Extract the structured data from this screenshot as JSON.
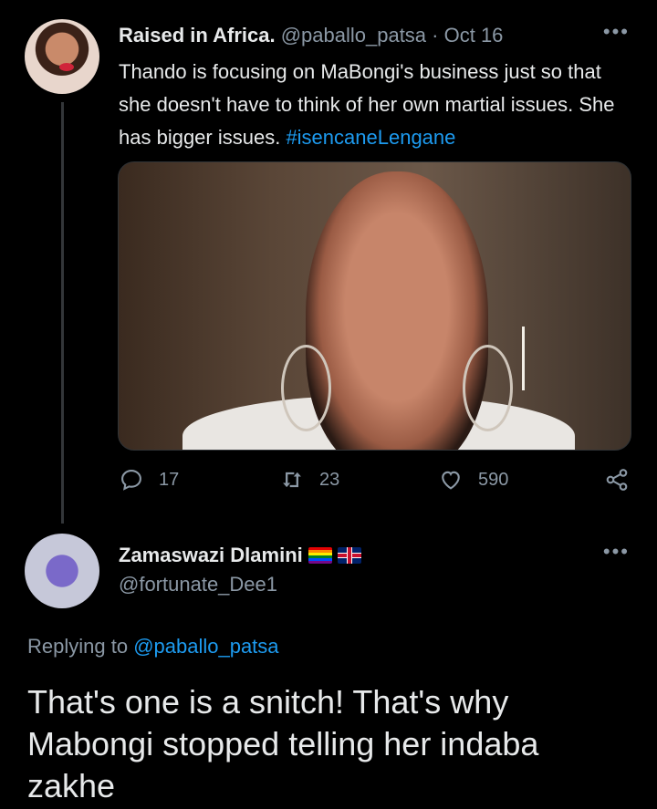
{
  "tweet": {
    "author_name": "Raised in Africa.",
    "handle": "@paballo_patsa",
    "separator": " · ",
    "date": "Oct 16",
    "more": "•••",
    "text": "Thando is focusing on MaBongi's business just so that she doesn't have to think of her own martial issues. She has bigger issues. ",
    "hashtag": "#isencaneLengane",
    "actions": {
      "replies": "17",
      "retweets": "23",
      "likes": "590"
    }
  },
  "reply": {
    "author_name": "Zamaswazi Dlamini",
    "handle": "@fortunate_Dee1",
    "more": "•••",
    "replying_prefix": "Replying to ",
    "replying_to": "@paballo_patsa",
    "text": "That's one is a snitch! That's why Mabongi stopped telling her indaba zakhe"
  },
  "colors": {
    "background": "#000000",
    "accent": "#1d9bf0",
    "muted": "#8b98a5"
  }
}
